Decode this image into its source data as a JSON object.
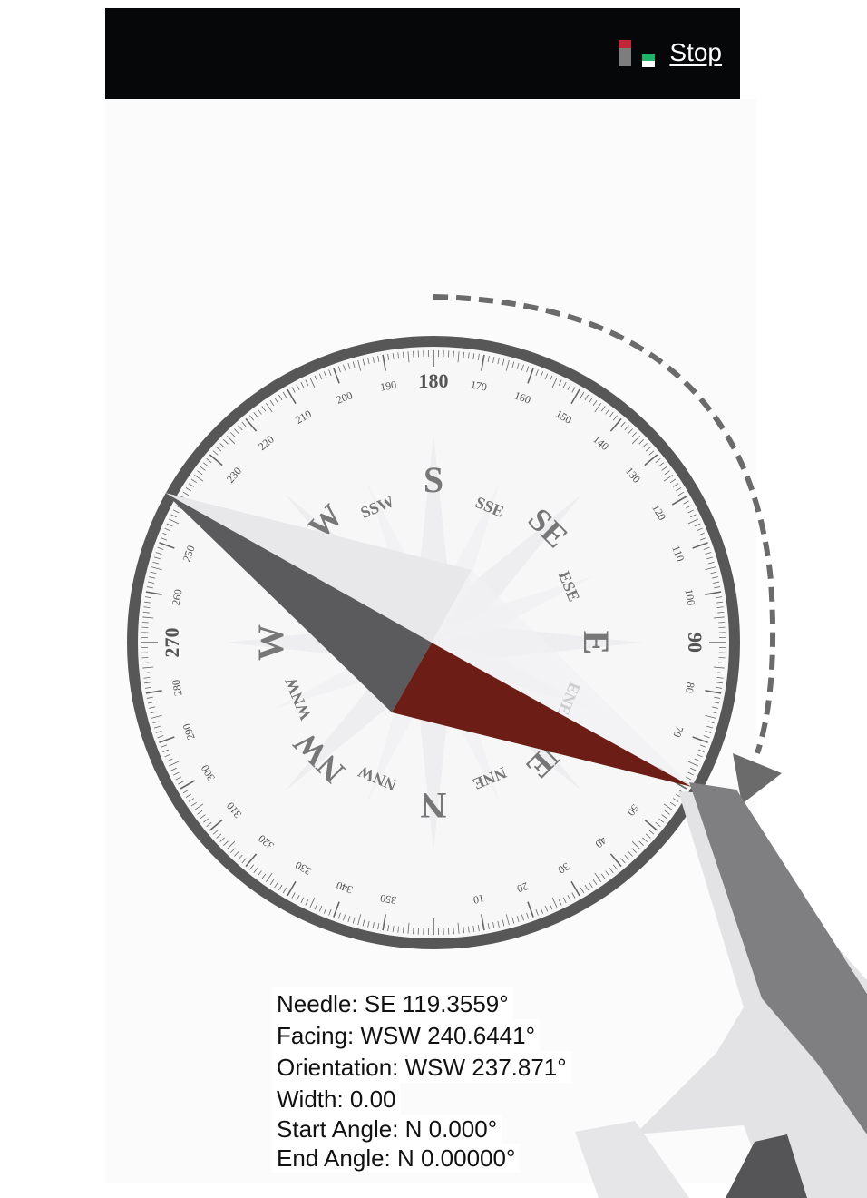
{
  "toolbar": {
    "stop_label": "Stop",
    "status_icon": "signal-status-icon",
    "status_colors": {
      "red": "#c0283a",
      "gray": "#7d7d7d",
      "green": "#20b36b"
    }
  },
  "compass": {
    "rotation_deg": 90,
    "needle_deg": 119.3559,
    "colors": {
      "ring": "#5c5c5c",
      "needle_red": "#6e1c15",
      "needle_dark": "#5a5a5c",
      "needle_light": "#e6e6e8"
    },
    "points": [
      "N",
      "NNE",
      "NE",
      "ENE",
      "E",
      "ESE",
      "SE",
      "SSE",
      "S",
      "SSW",
      "SW",
      "WSW",
      "W",
      "WNW",
      "NW",
      "NNW"
    ],
    "degree_labels": [
      "10",
      "20",
      "30",
      "40",
      "50",
      "60",
      "70",
      "80",
      "90",
      "100",
      "110",
      "120",
      "130",
      "140",
      "150",
      "160",
      "170",
      "180",
      "190",
      "200",
      "210",
      "220",
      "230",
      "240",
      "250",
      "260",
      "270",
      "280",
      "290",
      "300",
      "310",
      "320",
      "330",
      "340",
      "350"
    ]
  },
  "readouts": {
    "needle": "Needle: SE 119.3559°",
    "facing": "Facing: WSW 240.6441°",
    "orientation": "Orientation: WSW 237.871°",
    "width": "Width: 0.00",
    "start_angle": "Start Angle: N 0.000°",
    "end_angle": "End Angle: N 0.00000°"
  }
}
